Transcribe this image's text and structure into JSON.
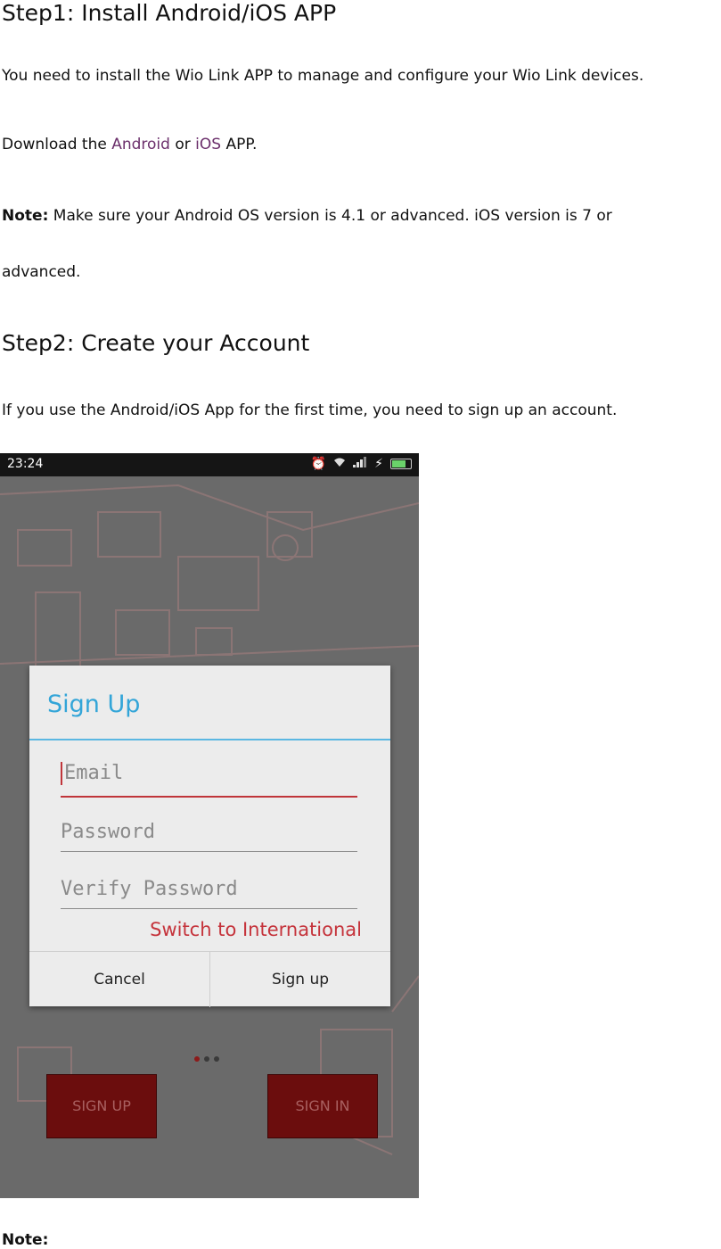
{
  "step1": {
    "heading": "Step1: Install Android/iOS APP",
    "intro": "You need to install the Wio Link APP to manage and configure your Wio Link devices.",
    "download_prefix": "Download the ",
    "android_link": "Android",
    "or_text": " or ",
    "ios_link": "iOS",
    "download_suffix": " APP.",
    "note_label": "Note:",
    "note_text": " Make sure your Android OS version is 4.1 or advanced. iOS version is 7 or",
    "note_text_cont": "advanced."
  },
  "step2": {
    "heading": "Step2: Create your Account",
    "intro": "If you use the Android/iOS App for the first time, you need to sign up an account."
  },
  "phone": {
    "status_time": "23:24",
    "dialog": {
      "title": "Sign Up",
      "email_placeholder": "Email",
      "password_placeholder": "Password",
      "verify_placeholder": "Verify Password",
      "switch_label": "Switch to International",
      "cancel_label": "Cancel",
      "signup_label": "Sign up"
    },
    "signup_button": "SIGN UP",
    "signin_button": "SIGN IN"
  },
  "footer_note": "Note:",
  "colors": {
    "link": "#6b2f6b",
    "dialog_title": "#33a5d8",
    "accent_red": "#c5333b",
    "app_button": "#6b0d0d"
  }
}
